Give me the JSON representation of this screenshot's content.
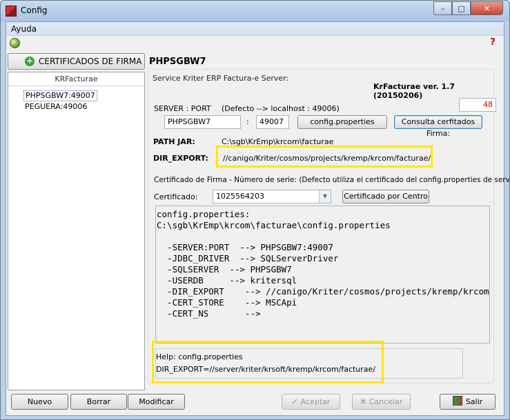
{
  "window": {
    "title": "Config"
  },
  "menu": {
    "items": [
      "Ayuda"
    ]
  },
  "left": {
    "cert_button": "CERTIFICADOS DE FIRMA",
    "list_header": "KRFacturae",
    "items": [
      "PHPSGBW7:49007",
      "PEGUERA:49006"
    ]
  },
  "main": {
    "server_name": "PHPSGBW7",
    "group_label": "Service Kriter ERP Factura-e Server:",
    "version": "KrFacturae ver. 1.7 (20150206)",
    "count": "48",
    "server_port_label": "SERVER : PORT",
    "default_hint": "(Defecto --> localhost : 49006)",
    "server_value": "PHPSGBW7",
    "colon": ":",
    "port_value": "49007",
    "btn_config": "config.properties",
    "btn_consulta": "Consulta cerfitados Firma:",
    "path_jar_label": "PATH JAR:",
    "path_jar_value": "C:\\sgb\\KrEmp\\krcom\\facturae",
    "dir_export_label": "DIR_EXPORT:",
    "dir_export_value": "//canigo/Kriter/cosmos/projects/kremp/krcom/facturae/",
    "cert_hint": "Certificado de Firma - Número de serie: (Defecto utiliza el certificado del config.properties de servicio)",
    "cert_label": "Certificado:",
    "cert_value": "1025564203",
    "btn_cert_centro": "Certificado por Centro",
    "code_lines": [
      "config.properties:",
      "C:\\sgb\\KrEmp\\krcom\\facturae\\config.properties",
      "",
      "  -SERVER:PORT  --> PHPSGBW7:49007",
      "  -JDBC_DRIVER  --> SQLServerDriver",
      "  -SQLSERVER  --> PHPSGBW7",
      "  -USERDB     --> kritersql",
      "  -DIR_EXPORT    --> //canigo/Kriter/cosmos/projects/kremp/krcom/facturae/",
      "  -CERT_STORE    --> MSCApi",
      "  -CERT_NS       -->"
    ],
    "help_title": "Help: config.properties",
    "help_text": "DIR_EXPORT=//server/kriter/krsoft/kremp/krcom/facturae/"
  },
  "buttons": {
    "nuevo": "Nuevo",
    "borrar": "Borrar",
    "modificar": "Modificar",
    "aceptar": "Aceptar",
    "cancelar": "Cancelar",
    "salir": "Salir"
  },
  "colors": {
    "highlight": "#ffe800",
    "count_text": "#cc0000"
  }
}
